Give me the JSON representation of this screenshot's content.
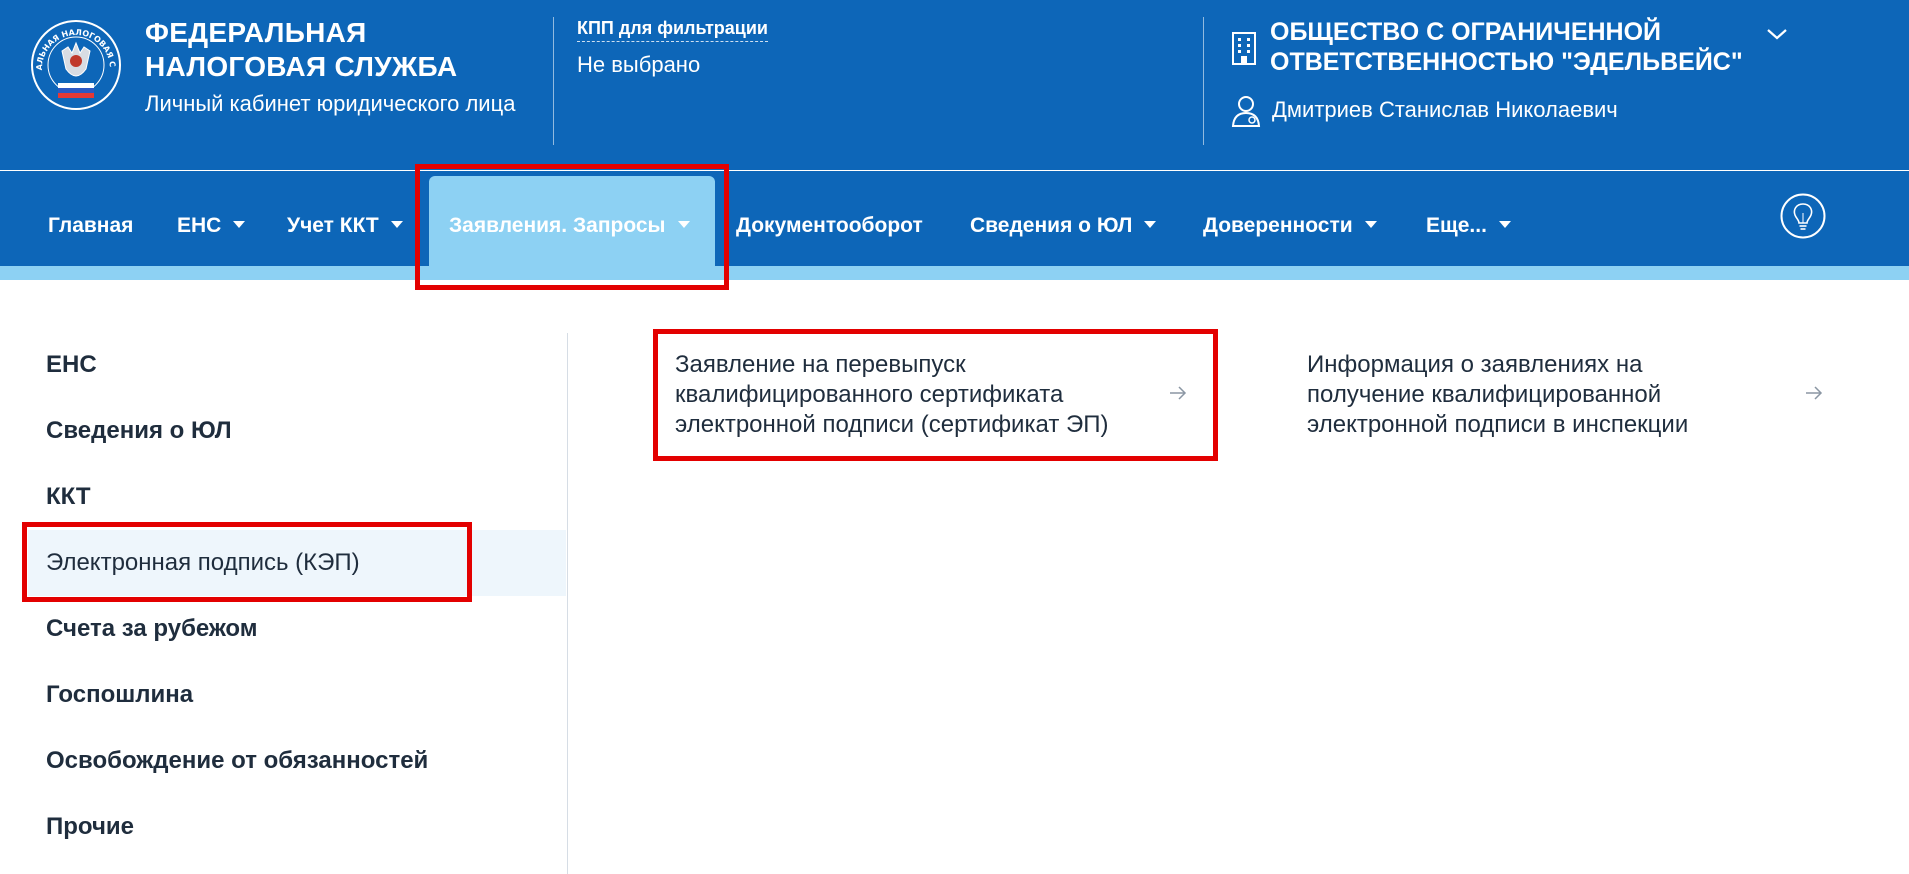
{
  "header": {
    "brand_line1": "ФЕДЕРАЛЬНАЯ",
    "brand_line2": "НАЛОГОВАЯ СЛУЖБА",
    "brand_sub": "Личный кабинет юридического лица",
    "emblem_text": "ФЕДЕРАЛЬНАЯ НАЛОГОВАЯ СЛУЖБА",
    "kpp_label": "КПП для фильтрации",
    "kpp_value": "Не выбрано",
    "org_line1": "ОБЩЕСТВО С ОГРАНИЧЕННОЙ",
    "org_line2": "ОТВЕТСТВЕННОСТЬЮ \"ЭДЕЛЬВЕЙС\"",
    "user_name": "Дмитриев Станислав Николаевич"
  },
  "nav": {
    "items": [
      {
        "label": "Главная"
      },
      {
        "label": "ЕНС"
      },
      {
        "label": "Учет ККТ"
      },
      {
        "label": "Заявления. Запросы"
      },
      {
        "label": "Документооборот"
      },
      {
        "label": "Сведения о ЮЛ"
      },
      {
        "label": "Доверенности"
      },
      {
        "label": "Еще..."
      }
    ]
  },
  "sidebar": {
    "items": [
      {
        "label": "ЕНС"
      },
      {
        "label": "Сведения о ЮЛ"
      },
      {
        "label": "ККТ"
      },
      {
        "label": "Электронная подпись (КЭП)"
      },
      {
        "label": "Счета за рубежом"
      },
      {
        "label": "Госпошлина"
      },
      {
        "label": "Освобождение от обязанностей"
      },
      {
        "label": "Прочие"
      }
    ]
  },
  "content": {
    "links": [
      {
        "line1": "Заявление на перевыпуск",
        "line2": "квалифицированного сертификата",
        "line3": "электронной подписи (сертификат ЭП)"
      },
      {
        "line1": "Информация о заявлениях на",
        "line2": "получение квалифицированной",
        "line3": "электронной подписи в инспекции"
      }
    ]
  },
  "colors": {
    "header_bg": "#0d66b8",
    "nav_active": "#8dd1f3",
    "highlight": "#e30000"
  }
}
